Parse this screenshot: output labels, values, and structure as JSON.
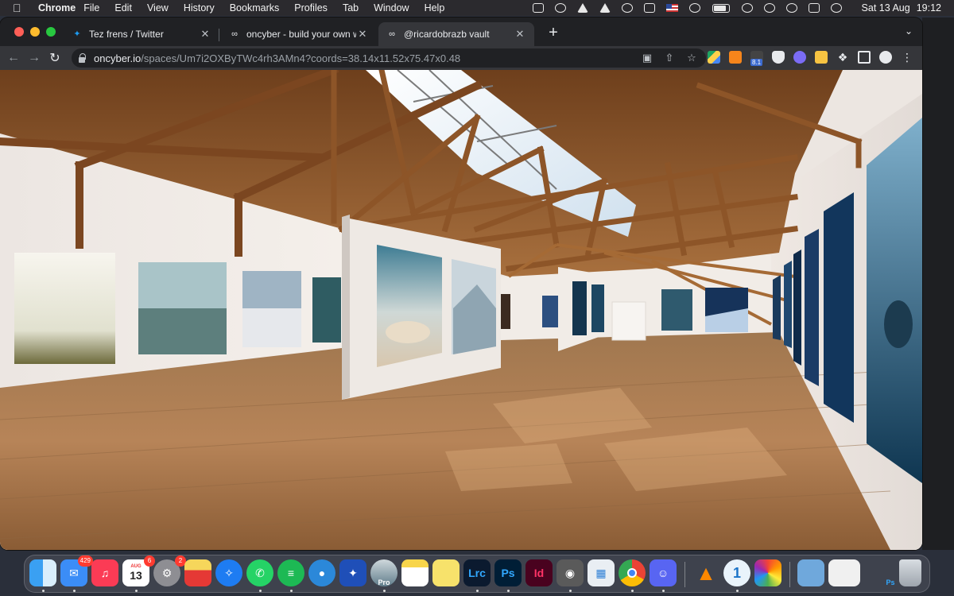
{
  "menubar": {
    "app_name": "Chrome",
    "menus": [
      "File",
      "Edit",
      "View",
      "History",
      "Bookmarks",
      "Profiles",
      "Tab",
      "Window",
      "Help"
    ],
    "date": "Sat 13 Aug",
    "time": "19:12"
  },
  "tabs": [
    {
      "title": "Tez frens / Twitter",
      "icon": "twitter-icon",
      "active": false
    },
    {
      "title": "oncyber - build your own world",
      "icon": "oncyber-icon",
      "active": false
    },
    {
      "title": "@ricardobrazb vault",
      "icon": "oncyber-icon",
      "active": true
    }
  ],
  "address_bar": {
    "host": "oncyber.io",
    "path": "/spaces/Um7i2OXByTWc4rh3AMn4?coords=38.14x11.52x75.47x0.48"
  },
  "extensions": {
    "badge": "8.1"
  },
  "gallery": {
    "scene": "3D virtual gallery with wooden roof trusses, skylight, and wooden floor",
    "wall_artworks": [
      "misty trees",
      "frosted forest",
      "clouds over mountains",
      "ocean wave",
      "desert dome",
      "misty mountain",
      "volcano",
      "underwater diver",
      "underwater figure",
      "aerial valley",
      "winter road",
      "underwater",
      "night sea",
      "pier at night",
      "whale underwater"
    ]
  },
  "dock": {
    "apps": [
      {
        "name": "Finder",
        "icon": "finder-icon",
        "badge": ""
      },
      {
        "name": "Mail",
        "icon": "mail-icon",
        "badge": "429"
      },
      {
        "name": "Music",
        "icon": "music-icon",
        "badge": ""
      },
      {
        "name": "Calendar",
        "icon": "calendar-icon",
        "badge": "6",
        "month": "AUG",
        "day": "13"
      },
      {
        "name": "System Preferences",
        "icon": "settings-icon",
        "badge": "2"
      },
      {
        "name": "Popcorn Time",
        "icon": "popcorn-icon",
        "badge": ""
      },
      {
        "name": "Safari",
        "icon": "safari-icon",
        "badge": ""
      },
      {
        "name": "WhatsApp",
        "icon": "whatsapp-icon",
        "badge": ""
      },
      {
        "name": "Spotify",
        "icon": "spotify-icon",
        "badge": ""
      },
      {
        "name": "Linear",
        "icon": "linear-icon",
        "badge": ""
      },
      {
        "name": "Bird",
        "icon": "bird-icon",
        "badge": ""
      },
      {
        "name": "Pro App",
        "icon": "pro-icon",
        "badge": "",
        "label": "Pro"
      },
      {
        "name": "Notes",
        "icon": "notes-icon",
        "badge": ""
      },
      {
        "name": "Stickies",
        "icon": "stickies-icon",
        "badge": ""
      },
      {
        "name": "Lightroom Classic",
        "icon": "lightroom-icon",
        "badge": "",
        "label": "Lrc"
      },
      {
        "name": "Photoshop",
        "icon": "photoshop-icon",
        "badge": "",
        "label": "Ps"
      },
      {
        "name": "InDesign",
        "icon": "indesign-icon",
        "badge": "",
        "label": "Id"
      },
      {
        "name": "Screenshot",
        "icon": "screenshot-icon",
        "badge": ""
      },
      {
        "name": "Keynote",
        "icon": "keynote-icon",
        "badge": ""
      },
      {
        "name": "Chrome",
        "icon": "chrome-icon",
        "badge": ""
      },
      {
        "name": "Discord",
        "icon": "discord-icon",
        "badge": ""
      },
      {
        "name": "VLC",
        "icon": "vlc-icon",
        "badge": ""
      },
      {
        "name": "1Password",
        "icon": "onepassword-icon",
        "badge": "",
        "label": "1"
      },
      {
        "name": "Photos",
        "icon": "photos-icon",
        "badge": ""
      },
      {
        "name": "Downloads",
        "icon": "folder-icon",
        "badge": ""
      },
      {
        "name": "Window",
        "icon": "window-icon",
        "badge": ""
      },
      {
        "name": "Photoshop Doc",
        "icon": "ps-doc-icon",
        "badge": "",
        "label": "Ps"
      },
      {
        "name": "Trash",
        "icon": "trash-icon",
        "badge": ""
      }
    ]
  }
}
